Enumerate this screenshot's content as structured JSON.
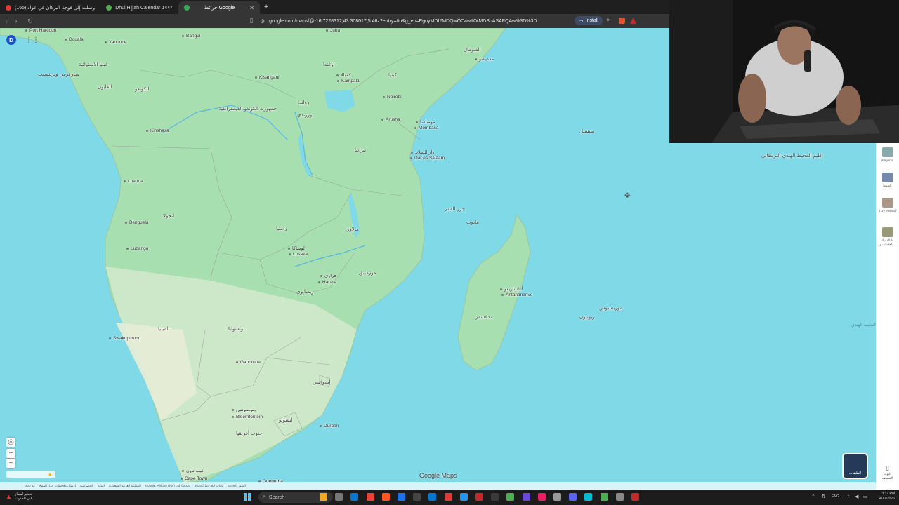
{
  "browser": {
    "tabs": [
      {
        "label": "(165) وصلت إلى قوجة البركان في عواد",
        "favicon_color": "#e53935"
      },
      {
        "label": "Dhul Hijjah Calendar 1447",
        "favicon_color": "#4caf50"
      },
      {
        "label": "خرائط Google",
        "favicon_color": "#34a853",
        "active": true
      }
    ],
    "url": "google.com/maps/@-16.7228312,43.308017,5.46z?entry=ttu&g_ep=EgoyMDI2MDQwOC4wIKXMDSoASAFQAw%3D%3D",
    "install_label": "Install"
  },
  "map": {
    "account_initial": "D",
    "brand": "Google Maps",
    "layers_label": "الطبقات",
    "attribution": [
      "200 كم",
      "إرسال ملاحظات حول المنتج",
      "الخصوصية",
      "البنود",
      "المملكة العربية السعودية",
      "Google, AfriGIS (Pty) Ltd ©2026",
      "بيانات الخرائط ©2026",
      "الصور ©2026"
    ],
    "labels": [
      {
        "text": "Port Harcourt",
        "kind": "city"
      },
      {
        "text": "Douala",
        "kind": "city"
      },
      {
        "text": "Yaounde",
        "kind": "city"
      },
      {
        "text": "Bangui",
        "kind": "city"
      },
      {
        "text": "Juba",
        "kind": "city"
      },
      {
        "text": "الصومال",
        "kind": "country"
      },
      {
        "text": "مقديشو",
        "kind": "city"
      },
      {
        "text": "غينيا الاستوائية",
        "kind": "country"
      },
      {
        "text": "ساو تومي وبرينسيب",
        "kind": "country"
      },
      {
        "text": "الغابون",
        "kind": "country"
      },
      {
        "text": "الكونغو",
        "kind": "country"
      },
      {
        "text": "أوغندا",
        "kind": "country"
      },
      {
        "text": "كمبالا",
        "kind": "city"
      },
      {
        "text": "Kampala",
        "kind": "city"
      },
      {
        "text": "كينيا",
        "kind": "country"
      },
      {
        "text": "Nairobi",
        "kind": "city"
      },
      {
        "text": "Kisangani",
        "kind": "city"
      },
      {
        "text": "جمهورية الكونغو الديمقراطية",
        "kind": "country"
      },
      {
        "text": "رواندا",
        "kind": "country"
      },
      {
        "text": "بوروندي",
        "kind": "country"
      },
      {
        "text": "Arusha",
        "kind": "city"
      },
      {
        "text": "مومباسا",
        "kind": "city"
      },
      {
        "text": "Mombasa",
        "kind": "city"
      },
      {
        "text": "سيشيل",
        "kind": "country"
      },
      {
        "text": "Kinshasa",
        "kind": "city"
      },
      {
        "text": "تنزانيا",
        "kind": "country"
      },
      {
        "text": "دار السلام",
        "kind": "city"
      },
      {
        "text": "Dar es Salaam",
        "kind": "city"
      },
      {
        "text": "إقليم المحيط الهندي البريطاني",
        "kind": "country"
      },
      {
        "text": "Luanda",
        "kind": "city"
      },
      {
        "text": "أنجولا",
        "kind": "country"
      },
      {
        "text": "جزر القمر",
        "kind": "country"
      },
      {
        "text": "مايوت",
        "kind": "country"
      },
      {
        "text": "Benguela",
        "kind": "city"
      },
      {
        "text": "زامبيا",
        "kind": "country"
      },
      {
        "text": "مالاوي",
        "kind": "country"
      },
      {
        "text": "Lubango",
        "kind": "city"
      },
      {
        "text": "لوساكا",
        "kind": "city"
      },
      {
        "text": "Lusaka",
        "kind": "city"
      },
      {
        "text": "موزمبيق",
        "kind": "country"
      },
      {
        "text": "هراري",
        "kind": "city"
      },
      {
        "text": "Harare",
        "kind": "city"
      },
      {
        "text": "أنتاناناريفو",
        "kind": "city"
      },
      {
        "text": "Antananarivo",
        "kind": "city"
      },
      {
        "text": "زيمبابوي",
        "kind": "country"
      },
      {
        "text": "موريشيوس",
        "kind": "country"
      },
      {
        "text": "ريونيون",
        "kind": "country"
      },
      {
        "text": "مدغشقر",
        "kind": "country"
      },
      {
        "text": "ناميبيا",
        "kind": "country"
      },
      {
        "text": "بوتسوانا",
        "kind": "country"
      },
      {
        "text": "Swakopmund",
        "kind": "city"
      },
      {
        "text": "المحيط الهندي",
        "kind": "sea"
      },
      {
        "text": "Gaborone",
        "kind": "city"
      },
      {
        "text": "إسواتيني",
        "kind": "country"
      },
      {
        "text": "بلومفونتين",
        "kind": "city"
      },
      {
        "text": "Bloemfontein",
        "kind": "city"
      },
      {
        "text": "ليسوتو",
        "kind": "country"
      },
      {
        "text": "Durban",
        "kind": "city"
      },
      {
        "text": "جنوب أفريقيا",
        "kind": "country"
      },
      {
        "text": "كيب تاون",
        "kind": "city"
      },
      {
        "text": "Cape Town",
        "kind": "city"
      },
      {
        "text": "Gqeberha",
        "kind": "city"
      }
    ]
  },
  "side_panel": {
    "items": [
      {
        "label": "atagonia",
        "color": "#8aa"
      },
      {
        "label": "باطوما",
        "color": "#78a"
      },
      {
        "label": "TUV einland",
        "color": "#a98"
      },
      {
        "label": "فاتالة نيك للعلامات و..",
        "color": "#997"
      }
    ],
    "bottom_label": "اليوت المضيف"
  },
  "taskbar": {
    "weather_line1": "تحذير أمطار",
    "weather_line2": "قبل الحدوث",
    "search_label": "Search",
    "language": "ENG",
    "time": "3:37 PM",
    "date": "4/11/2026",
    "icon_colors": [
      "#f5a623",
      "#777",
      "#0078d4",
      "#ea4335",
      "#ff5722",
      "#1a73e8",
      "#444",
      "#0078d4",
      "#e53935",
      "#2196f3",
      "#c62828",
      "#3a3a3a",
      "#4caf50",
      "#6b47dc",
      "#e91e63",
      "#999",
      "#5865f2",
      "#00bcd4",
      "#4caf50",
      "#888",
      "#c62828"
    ]
  }
}
